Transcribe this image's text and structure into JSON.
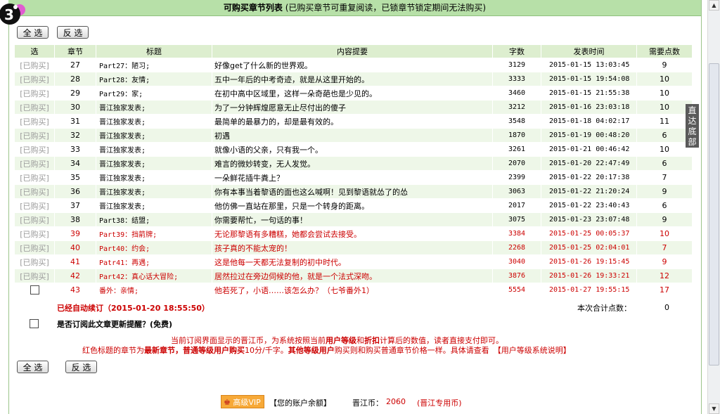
{
  "header": {
    "title_bold": "可购买章节列表",
    "title_note": "(已购买章节可重复阅读，已锁章节锁定期间无法购买)"
  },
  "logo": {
    "badge_text": "3"
  },
  "buttons": {
    "select_all": "全 选",
    "invert": "反 选"
  },
  "side_tab": {
    "label": "直达底部"
  },
  "columns": [
    "选",
    "章节",
    "标题",
    "内容提要",
    "字数",
    "发表时间",
    "需要点数"
  ],
  "rows": [
    {
      "sel": "[已购买]",
      "num": "27",
      "title": "Part27：陋习;",
      "summary": "好像get了什么新的世界观。",
      "words": "3129",
      "date": "2015-01-15 13:03:45",
      "points": "9",
      "red": false
    },
    {
      "sel": "[已购买]",
      "num": "28",
      "title": "Part28：友情;",
      "summary": "五中一年后的中考奇迹，就是从这里开始的。",
      "words": "3333",
      "date": "2015-01-15 19:54:08",
      "points": "10",
      "red": false
    },
    {
      "sel": "[已购买]",
      "num": "29",
      "title": "Part29：家;",
      "summary": "在初中高中区域里，这样一朵奇葩也是少见的。",
      "words": "3460",
      "date": "2015-01-15 21:55:38",
      "points": "10",
      "red": false
    },
    {
      "sel": "[已购买]",
      "num": "30",
      "title": "晋江独家发表;",
      "summary": "为了一分钟辉煌愿意无止尽付出的傻子",
      "words": "3212",
      "date": "2015-01-16 23:03:18",
      "points": "10",
      "red": false
    },
    {
      "sel": "[已购买]",
      "num": "31",
      "title": "晋江独家发表;",
      "summary": "最简单的最暴力的，却是最有效的。",
      "words": "3548",
      "date": "2015-01-18 04:02:17",
      "points": "11",
      "red": false
    },
    {
      "sel": "[已购买]",
      "num": "32",
      "title": "晋江独家发表;",
      "summary": "初遇",
      "words": "1870",
      "date": "2015-01-19 00:48:20",
      "points": "6",
      "red": false
    },
    {
      "sel": "[已购买]",
      "num": "33",
      "title": "晋江独家发表;",
      "summary": "就像小语的父亲，只有我一个。",
      "words": "3261",
      "date": "2015-01-21 00:46:42",
      "points": "10",
      "red": false
    },
    {
      "sel": "[已购买]",
      "num": "34",
      "title": "晋江独家发表;",
      "summary": "难言的微妙转变，无人发觉。",
      "words": "2070",
      "date": "2015-01-20 22:47:49",
      "points": "6",
      "red": false
    },
    {
      "sel": "[已购买]",
      "num": "35",
      "title": "晋江独家发表;",
      "summary": "一朵鲜花插牛粪上？",
      "words": "2399",
      "date": "2015-01-22 20:17:38",
      "points": "7",
      "red": false
    },
    {
      "sel": "[已购买]",
      "num": "36",
      "title": "晋江独家发表;",
      "summary": "你有本事当着黎语的面也这么喊啊！见到黎语就怂了的怂",
      "words": "3063",
      "date": "2015-01-22 21:20:24",
      "points": "9",
      "red": false
    },
    {
      "sel": "[已购买]",
      "num": "37",
      "title": "晋江独家发表;",
      "summary": "他仿佛一直站在那里，只是一个转身的距离。",
      "words": "2017",
      "date": "2015-01-22 23:40:43",
      "points": "6",
      "red": false
    },
    {
      "sel": "[已购买]",
      "num": "38",
      "title": "Part38：结盟;",
      "summary": "你需要帮忙，一句话的事！",
      "words": "3075",
      "date": "2015-01-23 23:07:48",
      "points": "9",
      "red": false
    },
    {
      "sel": "[已购买]",
      "num": "39",
      "title": "Part39：挡箭牌;",
      "summary": "无论那黎语有多糟糕，她都会尝试去接受。",
      "words": "3384",
      "date": "2015-01-25 00:05:37",
      "points": "10",
      "red": true
    },
    {
      "sel": "[已购买]",
      "num": "40",
      "title": "Part40：约会;",
      "summary": "孩子真的不能太宠的！",
      "words": "2268",
      "date": "2015-01-25 02:04:01",
      "points": "7",
      "red": true
    },
    {
      "sel": "[已购买]",
      "num": "41",
      "title": "Patr41：再遇;",
      "summary": "这是他每一天都无法复制的初中时代。",
      "words": "3040",
      "date": "2015-01-26 19:15:45",
      "points": "9",
      "red": true
    },
    {
      "sel": "[已购买]",
      "num": "42",
      "title": "Part42：真心话大冒险;",
      "summary": "居然拉过在旁边伺候的他，就是一个法式深吻。",
      "words": "3876",
      "date": "2015-01-26 19:33:21",
      "points": "12",
      "red": true
    },
    {
      "sel": "",
      "num": "43",
      "title": "番外：亲情;",
      "summary": "他若死了，小语……该怎么办？（七爷番外1）",
      "words": "5554",
      "date": "2015-01-27 19:55:15",
      "points": "17",
      "red": true
    }
  ],
  "auto_sub": "已经自动续订（2015-01-20 18:55:50）",
  "total": {
    "label": "本次合计点数：",
    "value": "0"
  },
  "remind": "是否订阅此文章更新提醒？(免费)",
  "notice": {
    "l1a": "当前订阅界面显示的晋江币，为系统按照当前",
    "l1b": "用户等级",
    "l1c": "和",
    "l1d": "折扣",
    "l1e": "计算后的数值，读者直接支付即可。",
    "l2a": "红色标题的章节为",
    "l2b": "最新章节，普通等级用户购买",
    "l2c": "10分/千字。",
    "l2d": "其他等级用户",
    "l2e": "购买则和购买普通章节价格一样。具体请查看",
    "l2f": "【用户等级系统说明】"
  },
  "footer": {
    "vip": "高级VIP",
    "balance_label": "【您的账户余额】",
    "coin_label": "晋江币：",
    "coin_value": "2060",
    "coin_note": "(晋江专用币)"
  },
  "colors": {
    "header_bg": "#b7e0a8",
    "row_shade": "#eef7e8",
    "accent_red": "#cc0000"
  }
}
